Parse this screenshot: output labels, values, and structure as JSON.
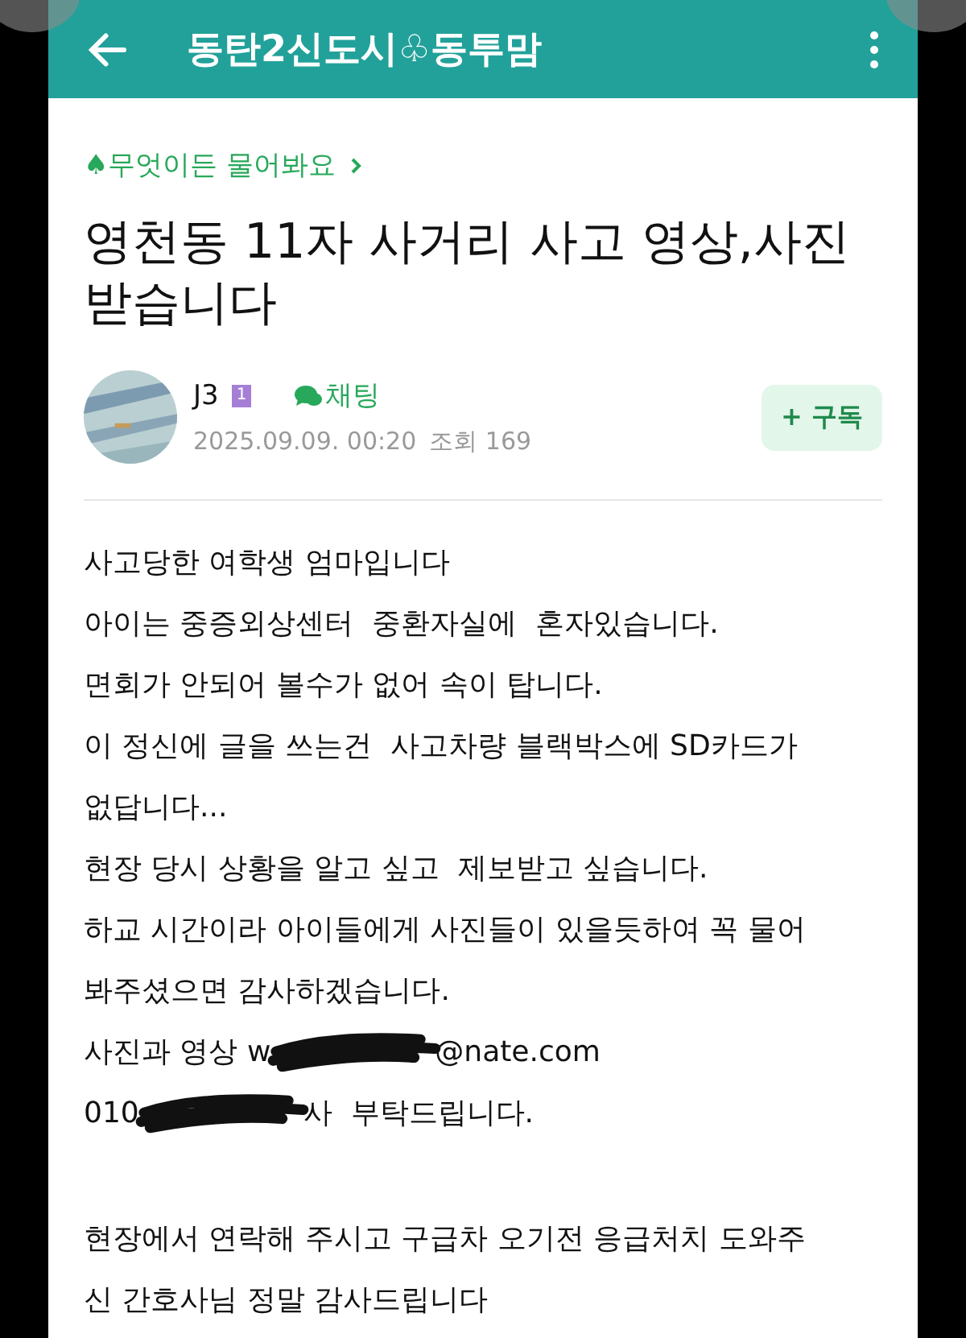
{
  "header": {
    "title": "동탄2신도시♧동투맘"
  },
  "post": {
    "category": "♠무엇이든 물어봐요",
    "title": "영천동 11자 사거리 사고 영상,사진 받습니다",
    "author": {
      "name": "J3",
      "level": "1",
      "chat": "채팅",
      "date": "2025.09.09. 00:20",
      "views": "조회 169",
      "subscribe": "+ 구독"
    },
    "lines": [
      [
        {
          "kind": "text",
          "text": "사고당한 여학생 엄마입니다"
        }
      ],
      [
        {
          "kind": "text",
          "text": "아이는 중증외상센터  중환자실에  혼자있습니다."
        }
      ],
      [
        {
          "kind": "text",
          "text": "면회가 안되어 볼수가 없어 속이 탑니다."
        }
      ],
      [
        {
          "kind": "text",
          "text": "이 정신에 글을 쓰는건  사고차량 블랙박스에 SD카드가"
        }
      ],
      [
        {
          "kind": "text",
          "text": "없답니다..."
        }
      ],
      [
        {
          "kind": "text",
          "text": "현장 당시 상황을 알고 싶고  제보받고 싶습니다."
        }
      ],
      [
        {
          "kind": "text",
          "text": "하교 시간이라 아이들에게 사진들이 있을듯하여 꼭 물어"
        }
      ],
      [
        {
          "kind": "text",
          "text": "봐주셨으면 감사하겠습니다."
        }
      ],
      [
        {
          "kind": "text",
          "text": "사진과 영상 w"
        },
        {
          "kind": "redacted"
        },
        {
          "kind": "text",
          "text": "@nate.com"
        }
      ],
      [
        {
          "kind": "text",
          "text": "010"
        },
        {
          "kind": "redacted"
        },
        {
          "kind": "text",
          "text": "사  부탁드립니다."
        }
      ],
      [
        {
          "kind": "blank"
        }
      ],
      [
        {
          "kind": "text",
          "text": "현장에서 연락해 주시고 구급차 오기전 응급처치 도와주"
        }
      ],
      [
        {
          "kind": "text",
          "text": "신 간호사님 정말 감사드립니다"
        }
      ]
    ]
  }
}
